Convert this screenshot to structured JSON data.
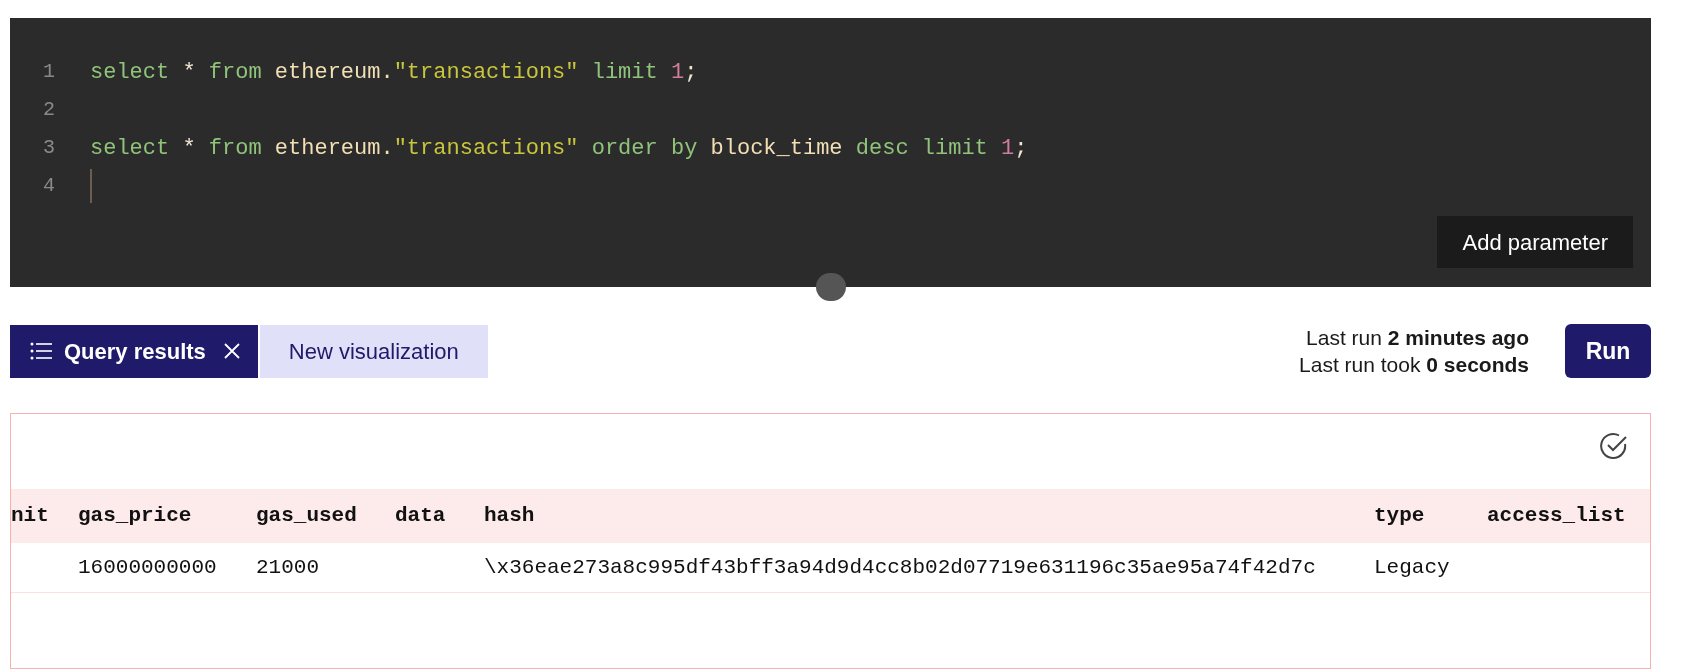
{
  "editor": {
    "lines": [
      {
        "number": "1",
        "cursor": false,
        "tokens": [
          {
            "text": "select",
            "kind": "keyword"
          },
          {
            "text": " * ",
            "kind": "plain"
          },
          {
            "text": "from",
            "kind": "keyword"
          },
          {
            "text": " ethereum.",
            "kind": "ident"
          },
          {
            "text": "\"transactions\"",
            "kind": "string"
          },
          {
            "text": " limit ",
            "kind": "keyword"
          },
          {
            "text": "1",
            "kind": "number"
          },
          {
            "text": ";",
            "kind": "plain"
          }
        ]
      },
      {
        "number": "2",
        "cursor": false
      },
      {
        "number": "3",
        "cursor": false,
        "tokens": [
          {
            "text": "select",
            "kind": "keyword"
          },
          {
            "text": " * ",
            "kind": "plain"
          },
          {
            "text": "from",
            "kind": "keyword"
          },
          {
            "text": " ethereum.",
            "kind": "ident"
          },
          {
            "text": "\"transactions\"",
            "kind": "string"
          },
          {
            "text": " order by ",
            "kind": "keyword"
          },
          {
            "text": "block_time",
            "kind": "ident"
          },
          {
            "text": " desc limit ",
            "kind": "keyword"
          },
          {
            "text": "1",
            "kind": "number"
          },
          {
            "text": ";",
            "kind": "plain"
          }
        ]
      },
      {
        "number": "4",
        "cursor": true
      }
    ],
    "add_parameter_button": "Add parameter"
  },
  "tabs": [
    {
      "label": "Query results",
      "selected": true
    },
    {
      "label": "New visualization",
      "selected": false
    }
  ],
  "run_info": [
    "Last run **2 minutes ago**",
    "Last run took **0 seconds**"
  ],
  "run_button": "Run",
  "table": {
    "columns": [
      "nit",
      "gas_price",
      "gas_used",
      "data",
      "hash",
      "type",
      "access_list"
    ],
    "rows": [
      [
        null,
        "16000000000",
        "21000",
        null,
        "\\x36eae273a8c995df43bff3a94d9d4cc8b02d07719e631196c35ae95a74f42d7c",
        "Legacy",
        null
      ]
    ]
  }
}
